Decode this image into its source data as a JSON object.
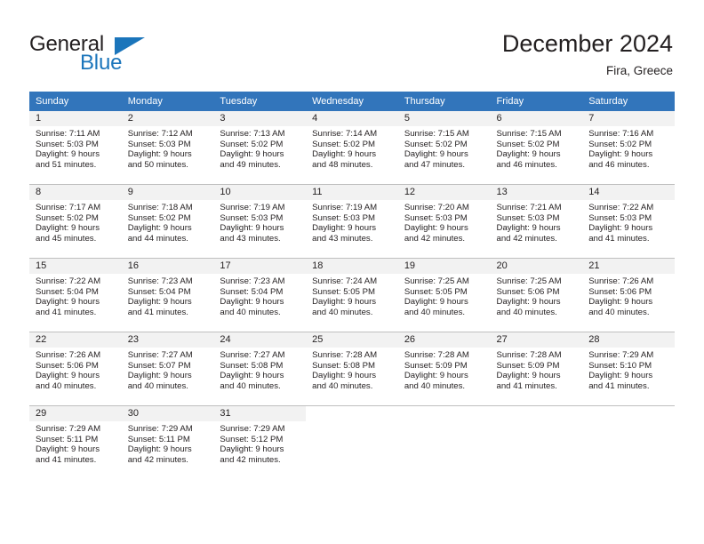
{
  "brand": {
    "name_part1": "General",
    "name_part2": "Blue",
    "flag_icon": "triangle-flag-icon"
  },
  "header": {
    "title": "December 2024",
    "location": "Fira, Greece"
  },
  "theme": {
    "header_blue": "#3275bb",
    "brand_blue": "#1b75bb",
    "day_band_gray": "#f2f2f2",
    "grid_line": "#bfbfbf",
    "text": "#231f20"
  },
  "calendar": {
    "weekday_headers": [
      "Sunday",
      "Monday",
      "Tuesday",
      "Wednesday",
      "Thursday",
      "Friday",
      "Saturday"
    ],
    "weeks": [
      [
        {
          "day": "1",
          "sunrise": "Sunrise: 7:11 AM",
          "sunset": "Sunset: 5:03 PM",
          "daylight_line1": "Daylight: 9 hours",
          "daylight_line2": "and 51 minutes."
        },
        {
          "day": "2",
          "sunrise": "Sunrise: 7:12 AM",
          "sunset": "Sunset: 5:03 PM",
          "daylight_line1": "Daylight: 9 hours",
          "daylight_line2": "and 50 minutes."
        },
        {
          "day": "3",
          "sunrise": "Sunrise: 7:13 AM",
          "sunset": "Sunset: 5:02 PM",
          "daylight_line1": "Daylight: 9 hours",
          "daylight_line2": "and 49 minutes."
        },
        {
          "day": "4",
          "sunrise": "Sunrise: 7:14 AM",
          "sunset": "Sunset: 5:02 PM",
          "daylight_line1": "Daylight: 9 hours",
          "daylight_line2": "and 48 minutes."
        },
        {
          "day": "5",
          "sunrise": "Sunrise: 7:15 AM",
          "sunset": "Sunset: 5:02 PM",
          "daylight_line1": "Daylight: 9 hours",
          "daylight_line2": "and 47 minutes."
        },
        {
          "day": "6",
          "sunrise": "Sunrise: 7:15 AM",
          "sunset": "Sunset: 5:02 PM",
          "daylight_line1": "Daylight: 9 hours",
          "daylight_line2": "and 46 minutes."
        },
        {
          "day": "7",
          "sunrise": "Sunrise: 7:16 AM",
          "sunset": "Sunset: 5:02 PM",
          "daylight_line1": "Daylight: 9 hours",
          "daylight_line2": "and 46 minutes."
        }
      ],
      [
        {
          "day": "8",
          "sunrise": "Sunrise: 7:17 AM",
          "sunset": "Sunset: 5:02 PM",
          "daylight_line1": "Daylight: 9 hours",
          "daylight_line2": "and 45 minutes."
        },
        {
          "day": "9",
          "sunrise": "Sunrise: 7:18 AM",
          "sunset": "Sunset: 5:02 PM",
          "daylight_line1": "Daylight: 9 hours",
          "daylight_line2": "and 44 minutes."
        },
        {
          "day": "10",
          "sunrise": "Sunrise: 7:19 AM",
          "sunset": "Sunset: 5:03 PM",
          "daylight_line1": "Daylight: 9 hours",
          "daylight_line2": "and 43 minutes."
        },
        {
          "day": "11",
          "sunrise": "Sunrise: 7:19 AM",
          "sunset": "Sunset: 5:03 PM",
          "daylight_line1": "Daylight: 9 hours",
          "daylight_line2": "and 43 minutes."
        },
        {
          "day": "12",
          "sunrise": "Sunrise: 7:20 AM",
          "sunset": "Sunset: 5:03 PM",
          "daylight_line1": "Daylight: 9 hours",
          "daylight_line2": "and 42 minutes."
        },
        {
          "day": "13",
          "sunrise": "Sunrise: 7:21 AM",
          "sunset": "Sunset: 5:03 PM",
          "daylight_line1": "Daylight: 9 hours",
          "daylight_line2": "and 42 minutes."
        },
        {
          "day": "14",
          "sunrise": "Sunrise: 7:22 AM",
          "sunset": "Sunset: 5:03 PM",
          "daylight_line1": "Daylight: 9 hours",
          "daylight_line2": "and 41 minutes."
        }
      ],
      [
        {
          "day": "15",
          "sunrise": "Sunrise: 7:22 AM",
          "sunset": "Sunset: 5:04 PM",
          "daylight_line1": "Daylight: 9 hours",
          "daylight_line2": "and 41 minutes."
        },
        {
          "day": "16",
          "sunrise": "Sunrise: 7:23 AM",
          "sunset": "Sunset: 5:04 PM",
          "daylight_line1": "Daylight: 9 hours",
          "daylight_line2": "and 41 minutes."
        },
        {
          "day": "17",
          "sunrise": "Sunrise: 7:23 AM",
          "sunset": "Sunset: 5:04 PM",
          "daylight_line1": "Daylight: 9 hours",
          "daylight_line2": "and 40 minutes."
        },
        {
          "day": "18",
          "sunrise": "Sunrise: 7:24 AM",
          "sunset": "Sunset: 5:05 PM",
          "daylight_line1": "Daylight: 9 hours",
          "daylight_line2": "and 40 minutes."
        },
        {
          "day": "19",
          "sunrise": "Sunrise: 7:25 AM",
          "sunset": "Sunset: 5:05 PM",
          "daylight_line1": "Daylight: 9 hours",
          "daylight_line2": "and 40 minutes."
        },
        {
          "day": "20",
          "sunrise": "Sunrise: 7:25 AM",
          "sunset": "Sunset: 5:06 PM",
          "daylight_line1": "Daylight: 9 hours",
          "daylight_line2": "and 40 minutes."
        },
        {
          "day": "21",
          "sunrise": "Sunrise: 7:26 AM",
          "sunset": "Sunset: 5:06 PM",
          "daylight_line1": "Daylight: 9 hours",
          "daylight_line2": "and 40 minutes."
        }
      ],
      [
        {
          "day": "22",
          "sunrise": "Sunrise: 7:26 AM",
          "sunset": "Sunset: 5:06 PM",
          "daylight_line1": "Daylight: 9 hours",
          "daylight_line2": "and 40 minutes."
        },
        {
          "day": "23",
          "sunrise": "Sunrise: 7:27 AM",
          "sunset": "Sunset: 5:07 PM",
          "daylight_line1": "Daylight: 9 hours",
          "daylight_line2": "and 40 minutes."
        },
        {
          "day": "24",
          "sunrise": "Sunrise: 7:27 AM",
          "sunset": "Sunset: 5:08 PM",
          "daylight_line1": "Daylight: 9 hours",
          "daylight_line2": "and 40 minutes."
        },
        {
          "day": "25",
          "sunrise": "Sunrise: 7:28 AM",
          "sunset": "Sunset: 5:08 PM",
          "daylight_line1": "Daylight: 9 hours",
          "daylight_line2": "and 40 minutes."
        },
        {
          "day": "26",
          "sunrise": "Sunrise: 7:28 AM",
          "sunset": "Sunset: 5:09 PM",
          "daylight_line1": "Daylight: 9 hours",
          "daylight_line2": "and 40 minutes."
        },
        {
          "day": "27",
          "sunrise": "Sunrise: 7:28 AM",
          "sunset": "Sunset: 5:09 PM",
          "daylight_line1": "Daylight: 9 hours",
          "daylight_line2": "and 41 minutes."
        },
        {
          "day": "28",
          "sunrise": "Sunrise: 7:29 AM",
          "sunset": "Sunset: 5:10 PM",
          "daylight_line1": "Daylight: 9 hours",
          "daylight_line2": "and 41 minutes."
        }
      ],
      [
        {
          "day": "29",
          "sunrise": "Sunrise: 7:29 AM",
          "sunset": "Sunset: 5:11 PM",
          "daylight_line1": "Daylight: 9 hours",
          "daylight_line2": "and 41 minutes."
        },
        {
          "day": "30",
          "sunrise": "Sunrise: 7:29 AM",
          "sunset": "Sunset: 5:11 PM",
          "daylight_line1": "Daylight: 9 hours",
          "daylight_line2": "and 42 minutes."
        },
        {
          "day": "31",
          "sunrise": "Sunrise: 7:29 AM",
          "sunset": "Sunset: 5:12 PM",
          "daylight_line1": "Daylight: 9 hours",
          "daylight_line2": "and 42 minutes."
        },
        {
          "day": "",
          "sunrise": "",
          "sunset": "",
          "daylight_line1": "",
          "daylight_line2": ""
        },
        {
          "day": "",
          "sunrise": "",
          "sunset": "",
          "daylight_line1": "",
          "daylight_line2": ""
        },
        {
          "day": "",
          "sunrise": "",
          "sunset": "",
          "daylight_line1": "",
          "daylight_line2": ""
        },
        {
          "day": "",
          "sunrise": "",
          "sunset": "",
          "daylight_line1": "",
          "daylight_line2": ""
        }
      ]
    ]
  }
}
